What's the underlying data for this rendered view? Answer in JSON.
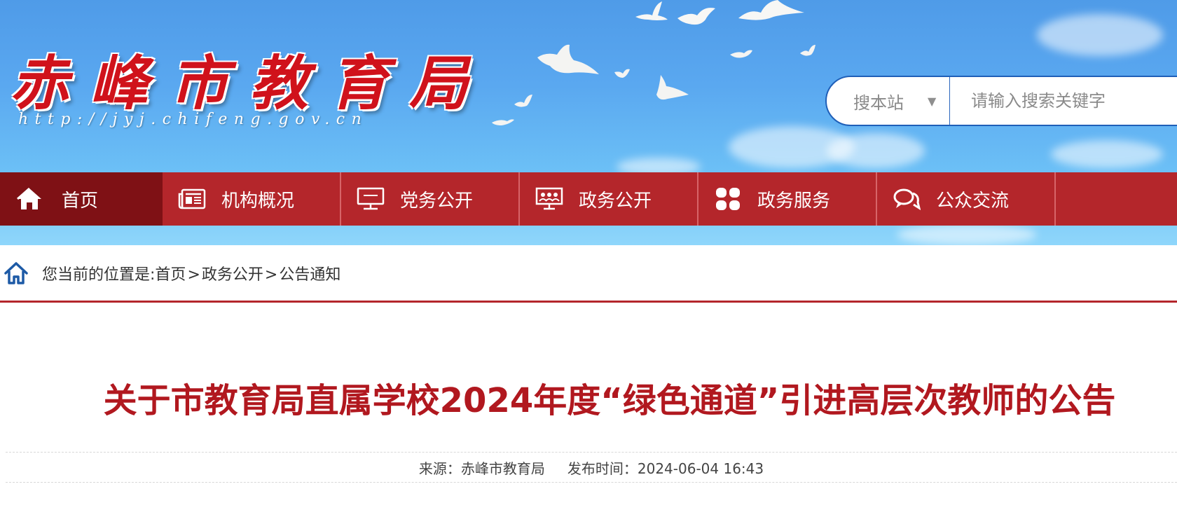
{
  "site": {
    "title": "赤峰市教育局",
    "url": "http://jyj.chifeng.gov.cn"
  },
  "search": {
    "scope_label": "搜本站",
    "scope_arrow": "▼",
    "placeholder": "请输入搜索关键字"
  },
  "nav": {
    "items": [
      {
        "label": "首页",
        "icon": "home-icon"
      },
      {
        "label": "机构概况",
        "icon": "newspaper-icon"
      },
      {
        "label": "党务公开",
        "icon": "monitor-icon"
      },
      {
        "label": "政务公开",
        "icon": "presentation-icon"
      },
      {
        "label": "政务服务",
        "icon": "grid-icon"
      },
      {
        "label": "公众交流",
        "icon": "chat-icon"
      }
    ]
  },
  "breadcrumb": {
    "prefix": "您当前的位置是:",
    "items": [
      "首页",
      "政务公开",
      "公告通知"
    ],
    "separator": ">"
  },
  "article": {
    "title": "关于市教育局直属学校2024年度“绿色通道”引进高层次教师的公告",
    "source_label": "来源：",
    "source": "赤峰市教育局",
    "published_label": "发布时间：",
    "published": "2024-06-04 16:43"
  },
  "colors": {
    "nav_red": "#b4262b",
    "nav_active": "#7f1115",
    "title_red": "#b1181f",
    "logo_red": "#d0121b",
    "search_border": "#1f5fb8"
  }
}
